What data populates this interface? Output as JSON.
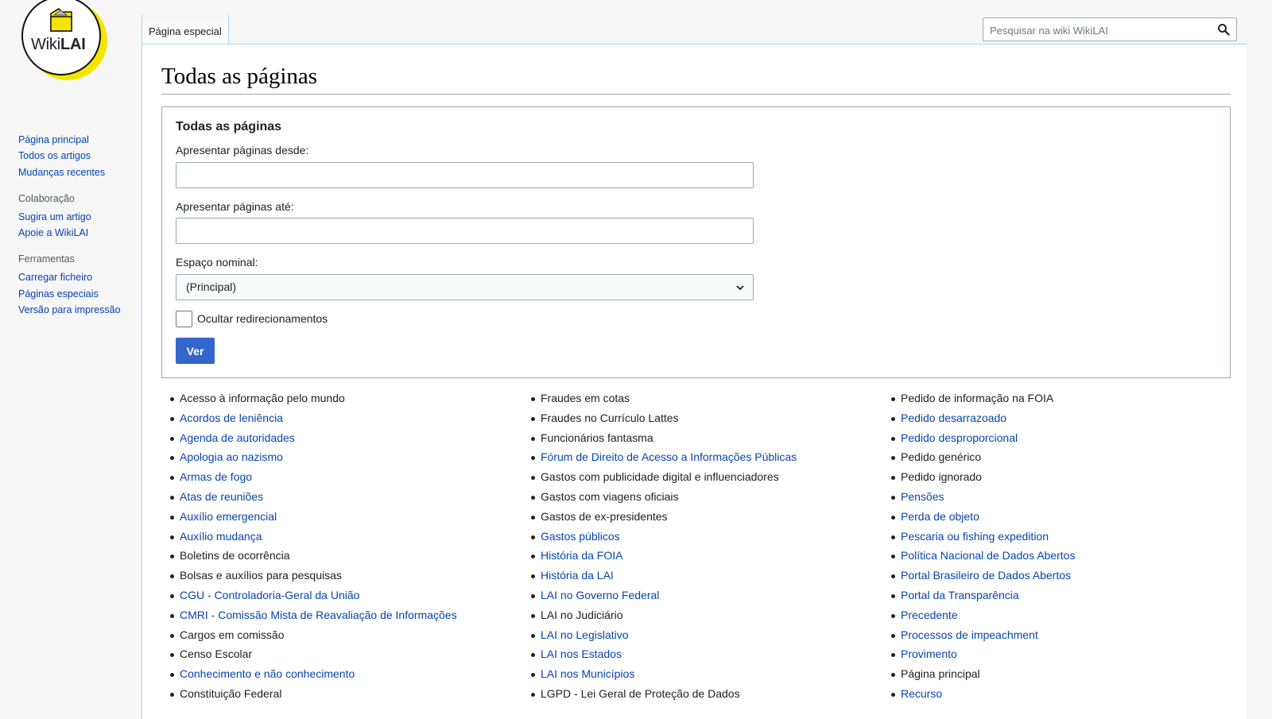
{
  "logo": {
    "word_1": "Wiki",
    "word_2": "LAI"
  },
  "tabs": [
    {
      "label": "Página especial"
    }
  ],
  "search": {
    "placeholder": "Pesquisar na wiki WikiLAI",
    "value": ""
  },
  "sidebar": {
    "nav": [
      "Página principal",
      "Todos os artigos",
      "Mudanças recentes"
    ],
    "sections": [
      {
        "heading": "Colaboração",
        "items": [
          "Sugira um artigo",
          "Apoie a WikiLAI"
        ]
      },
      {
        "heading": "Ferramentas",
        "items": [
          "Carregar ficheiro",
          "Páginas especiais",
          "Versão para impressão"
        ]
      }
    ]
  },
  "page": {
    "title": "Todas as páginas"
  },
  "form": {
    "legend": "Todas as páginas",
    "from_label": "Apresentar páginas desde:",
    "from_value": "",
    "to_label": "Apresentar páginas até:",
    "to_value": "",
    "namespace_label": "Espaço nominal:",
    "namespace_value": "(Principal)",
    "hide_redirects_label": "Ocultar redirecionamentos",
    "hide_redirects_checked": false,
    "submit_label": "Ver"
  },
  "colors": {
    "link": "#0645ad",
    "link_visited": "#0b0080",
    "button": "#3366cc",
    "logo_accent": "#f5e400"
  },
  "pages": {
    "col1": [
      {
        "t": "Acesso à informação pelo mundo",
        "s": "dark"
      },
      {
        "t": "Acordos de leniência",
        "s": "link"
      },
      {
        "t": "Agenda de autoridades",
        "s": "link"
      },
      {
        "t": "Apologia ao nazismo",
        "s": "link"
      },
      {
        "t": "Armas de fogo",
        "s": "link"
      },
      {
        "t": "Atas de reuniões",
        "s": "link"
      },
      {
        "t": "Auxílio emergencial",
        "s": "link"
      },
      {
        "t": "Auxílio mudança",
        "s": "link"
      },
      {
        "t": "Boletins de ocorrência",
        "s": "dark"
      },
      {
        "t": "Bolsas e auxílios para pesquisas",
        "s": "dark"
      },
      {
        "t": "CGU - Controladoria-Geral da União",
        "s": "link"
      },
      {
        "t": "CMRI - Comissão Mista de Reavaliação de Informações",
        "s": "link"
      },
      {
        "t": "Cargos em comissão",
        "s": "dark"
      },
      {
        "t": "Censo Escolar",
        "s": "dark"
      },
      {
        "t": "Conhecimento e não conhecimento",
        "s": "link"
      },
      {
        "t": "Constituição Federal",
        "s": "dark"
      }
    ],
    "col2": [
      {
        "t": "Fraudes em cotas",
        "s": "dark"
      },
      {
        "t": "Fraudes no Currículo Lattes",
        "s": "dark"
      },
      {
        "t": "Funcionários fantasma",
        "s": "dark"
      },
      {
        "t": "Fórum de Direito de Acesso a Informações Públicas",
        "s": "link"
      },
      {
        "t": "Gastos com publicidade digital e influenciadores",
        "s": "dark"
      },
      {
        "t": "Gastos com viagens oficiais",
        "s": "dark"
      },
      {
        "t": "Gastos de ex-presidentes",
        "s": "dark"
      },
      {
        "t": "Gastos públicos",
        "s": "link"
      },
      {
        "t": "História da FOIA",
        "s": "link"
      },
      {
        "t": "História da LAI",
        "s": "link"
      },
      {
        "t": "LAI no Governo Federal",
        "s": "link"
      },
      {
        "t": "LAI no Judiciário",
        "s": "dark"
      },
      {
        "t": "LAI no Legislativo",
        "s": "link"
      },
      {
        "t": "LAI nos Estados",
        "s": "link"
      },
      {
        "t": "LAI nos Municípios",
        "s": "link"
      },
      {
        "t": "LGPD - Lei Geral de Proteção de Dados",
        "s": "dark"
      }
    ],
    "col3": [
      {
        "t": "Pedido de informação na FOIA",
        "s": "dark"
      },
      {
        "t": "Pedido desarrazoado",
        "s": "link"
      },
      {
        "t": "Pedido desproporcional",
        "s": "link"
      },
      {
        "t": "Pedido genérico",
        "s": "dark"
      },
      {
        "t": "Pedido ignorado",
        "s": "dark"
      },
      {
        "t": "Pensões",
        "s": "link"
      },
      {
        "t": "Perda de objeto",
        "s": "link"
      },
      {
        "t": "Pescaria ou fishing expedition",
        "s": "link"
      },
      {
        "t": "Política Nacional de Dados Abertos",
        "s": "link"
      },
      {
        "t": "Portal Brasileiro de Dados Abertos",
        "s": "link"
      },
      {
        "t": "Portal da Transparência",
        "s": "link"
      },
      {
        "t": "Precedente",
        "s": "link"
      },
      {
        "t": "Processos de impeachment",
        "s": "link"
      },
      {
        "t": "Provimento",
        "s": "link"
      },
      {
        "t": "Página principal",
        "s": "dark"
      },
      {
        "t": "Recurso",
        "s": "link"
      }
    ]
  }
}
